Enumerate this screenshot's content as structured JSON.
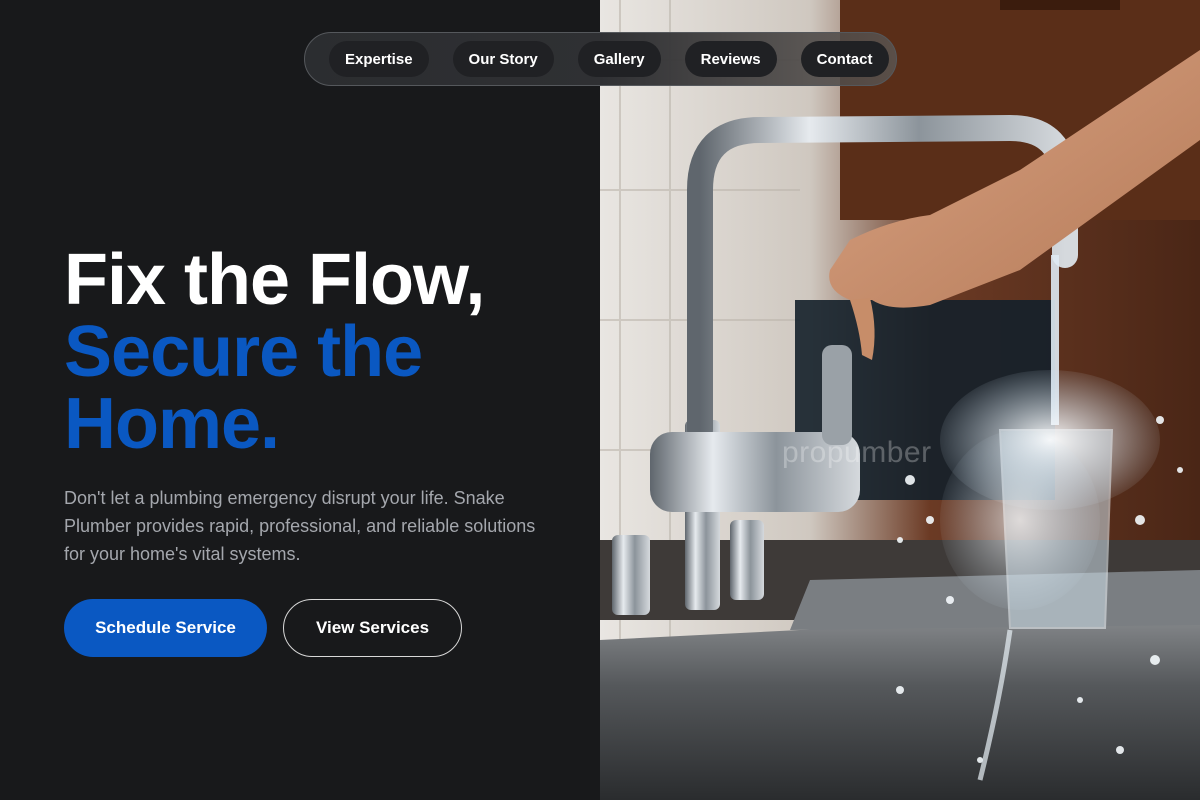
{
  "nav": {
    "items": [
      {
        "label": "Expertise"
      },
      {
        "label": "Our Story"
      },
      {
        "label": "Gallery"
      },
      {
        "label": "Reviews"
      },
      {
        "label": "Contact"
      }
    ]
  },
  "hero": {
    "title_line1": "Fix the Flow,",
    "title_line2": "Secure the Home.",
    "description": "Don't let a plumbing emergency disrupt your life. Snake Plumber provides rapid, professional, and reliable solutions for your home's vital systems.",
    "primary_button": "Schedule Service",
    "secondary_button": "View Services"
  },
  "image": {
    "subject": "hand turning chrome kitchen faucet with water splashing into glass over steel sink",
    "watermark": "propumber"
  },
  "colors": {
    "background": "#18191b",
    "accent": "#0a58c2",
    "text_primary": "#ffffff",
    "text_muted": "#a4a7ad"
  }
}
